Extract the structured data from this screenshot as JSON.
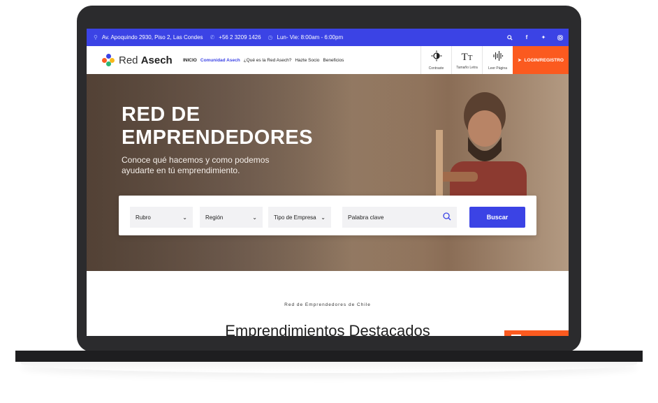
{
  "topbar": {
    "address": "Av. Apoquindo 2930, Piso 2, Las Condes",
    "phone": "+56 2 3209 1426",
    "hours": "Lun- Vie: 8:00am - 6:00pm",
    "icons": [
      "location-icon",
      "phone-icon",
      "clock-icon"
    ],
    "social": [
      "search-icon",
      "facebook-icon",
      "twitter-icon",
      "instagram-icon"
    ],
    "color": "#3b43e5"
  },
  "nav": {
    "logo_light": "Red ",
    "logo_bold": "Asech",
    "menu": [
      "INICIO",
      "Comunidad Asech",
      "¿Qué es la Red Asech?",
      "Hazte Socio",
      "Beneficios"
    ],
    "tools": [
      {
        "icon": "contrast-icon",
        "label": "Contraste"
      },
      {
        "icon": "text-size-icon",
        "label": "Tamaño Letra"
      },
      {
        "icon": "audio-wave-icon",
        "label": "Leer Página"
      }
    ],
    "login": "LOGIN/REGISTRO",
    "login_color": "#fb5a1f"
  },
  "hero": {
    "title_line1": "RED DE",
    "title_line2": "EMPRENDEDORES",
    "subtitle": "Conoce qué hacemos y como podemos ayudarte en tú emprendimiento."
  },
  "search": {
    "rubro": "Rubro",
    "region": "Región",
    "tipo": "Tipo de Empresa",
    "keyword_placeholder": "Palabra clave",
    "button": "Buscar"
  },
  "section": {
    "kicker": "Red de Emprendedores de Chile",
    "title": "Emprendimientos Destacados"
  }
}
